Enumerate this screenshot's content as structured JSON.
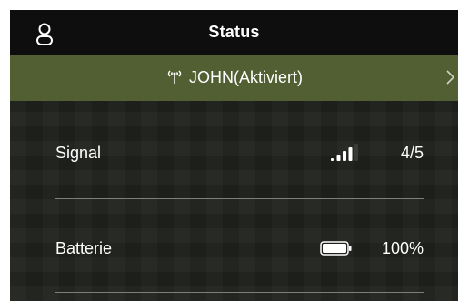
{
  "header": {
    "title": "Status",
    "profile_icon": "user-profile-icon"
  },
  "device": {
    "name": "JOHN(Aktiviert)",
    "icon": "antenna-icon",
    "chevron_icon": "chevron-right-icon",
    "background": "#525f33"
  },
  "signal": {
    "label": "Signal",
    "value": "4/5",
    "level": 4,
    "max": 5,
    "icon": "signal-bars-icon"
  },
  "battery": {
    "label": "Batterie",
    "value": "100%",
    "level": 1.0,
    "icon": "battery-icon"
  }
}
